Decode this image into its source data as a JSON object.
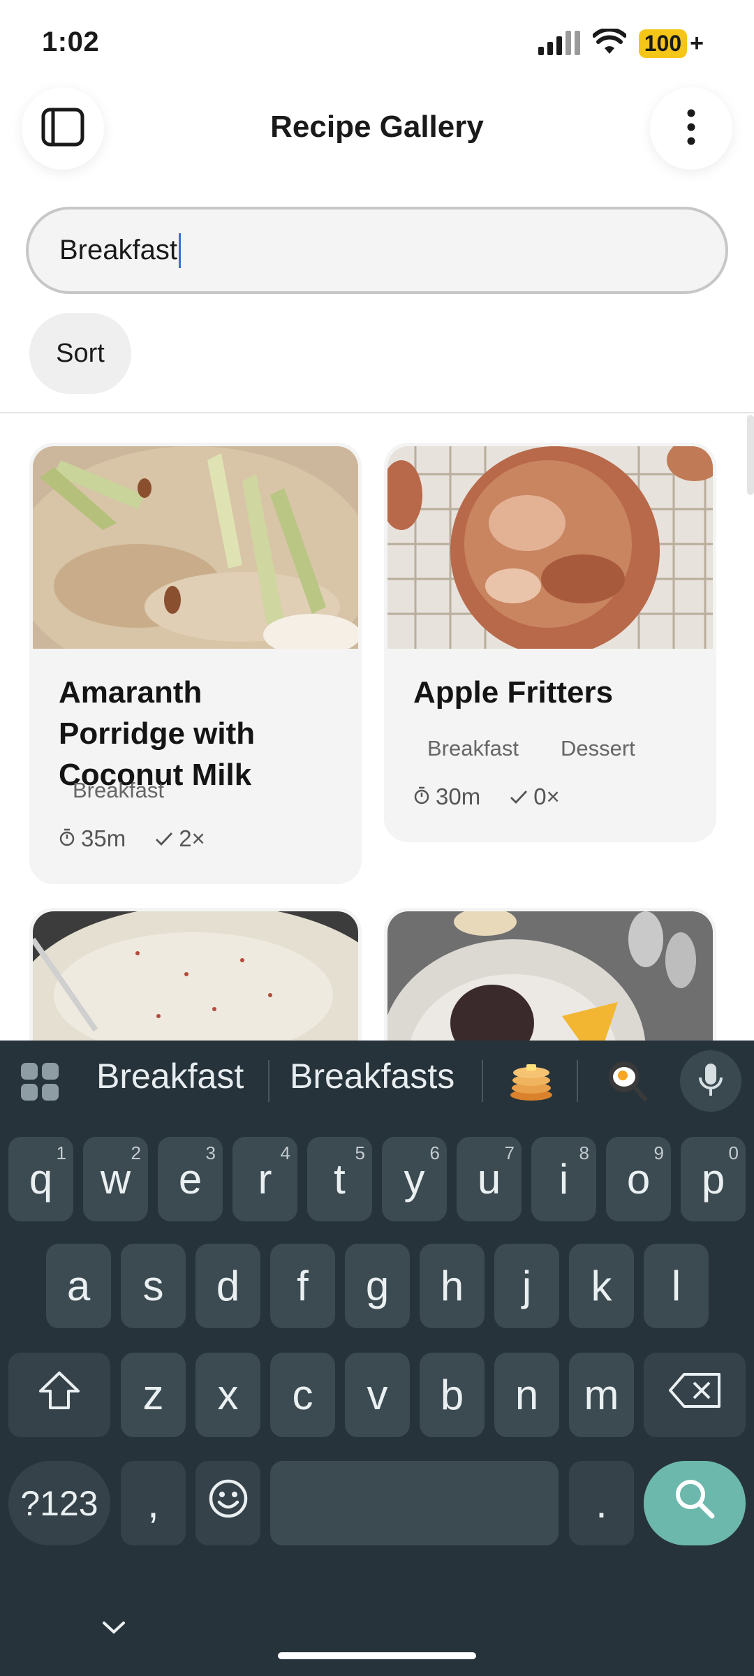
{
  "status_bar": {
    "time": "1:02",
    "battery": "100",
    "battery_suffix": "+"
  },
  "header": {
    "title": "Recipe Gallery"
  },
  "search": {
    "value": "Breakfast",
    "placeholder": ""
  },
  "sort": {
    "label": "Sort"
  },
  "recipes": [
    {
      "title": "Amaranth Porridge with Coconut Milk",
      "tags": [
        "Breakfast"
      ],
      "time": "35m",
      "made": "2×"
    },
    {
      "title": "Apple Fritters",
      "tags": [
        "Breakfast",
        "Dessert"
      ],
      "time": "30m",
      "made": "0×"
    }
  ],
  "keyboard": {
    "suggestions": [
      "Breakfast",
      "Breakfasts"
    ],
    "emoji_suggestions": [
      "pancakes-emoji",
      "fried-egg-emoji"
    ],
    "row1": [
      "q",
      "w",
      "e",
      "r",
      "t",
      "y",
      "u",
      "i",
      "o",
      "p"
    ],
    "row1_hints": [
      "1",
      "2",
      "3",
      "4",
      "5",
      "6",
      "7",
      "8",
      "9",
      "0"
    ],
    "row2": [
      "a",
      "s",
      "d",
      "f",
      "g",
      "h",
      "j",
      "k",
      "l"
    ],
    "row3": [
      "z",
      "x",
      "c",
      "v",
      "b",
      "n",
      "m"
    ],
    "symbols_key": "?123",
    "comma": ",",
    "period": "."
  },
  "colors": {
    "accent": "#6cb8ac",
    "keyboard_bg": "#27333a",
    "key_bg": "#3c4a51",
    "battery": "#f5c518"
  }
}
